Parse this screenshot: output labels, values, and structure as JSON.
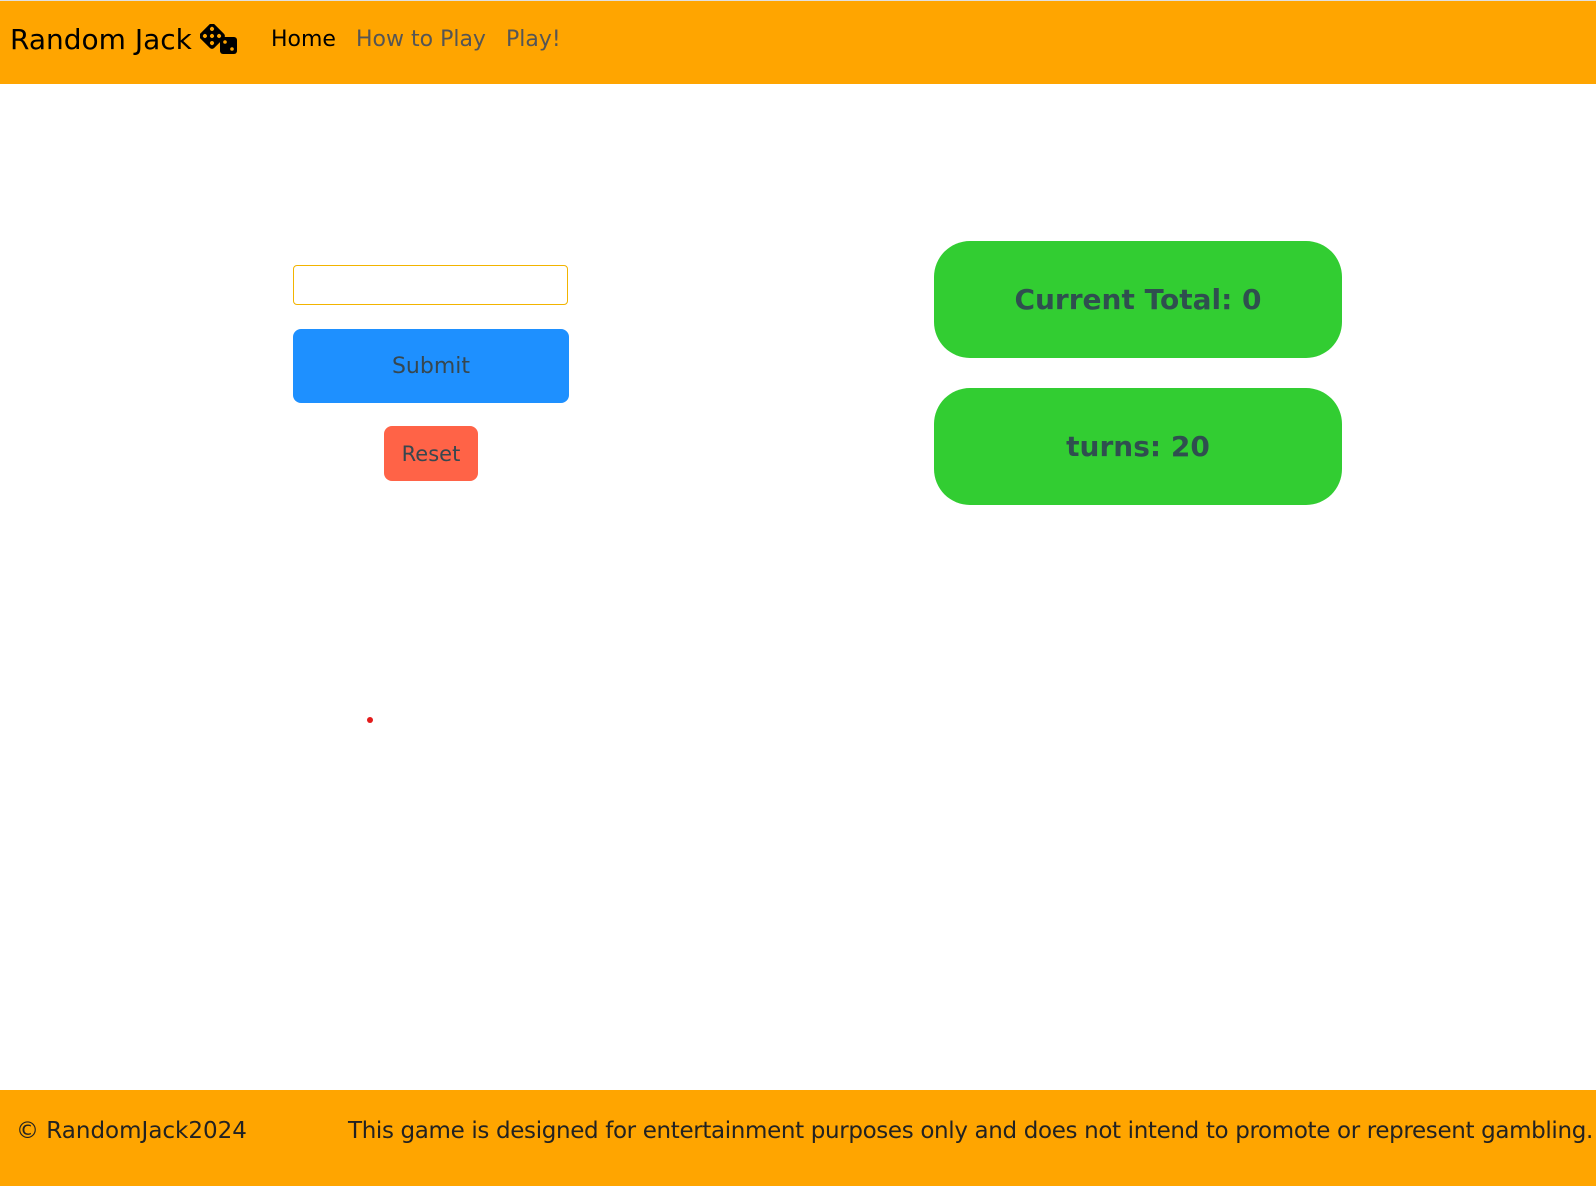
{
  "navbar": {
    "brand": "Random Jack",
    "brand_icon": "dice-icon",
    "links": [
      {
        "label": "Home",
        "active": true
      },
      {
        "label": "How to Play",
        "active": false
      },
      {
        "label": "Play!",
        "active": false
      }
    ]
  },
  "game": {
    "input_value": "",
    "submit_label": "Submit",
    "reset_label": "Reset",
    "current_total": "Current Total: 0",
    "turns": "turns: 20"
  },
  "footer": {
    "copyright": "© RandomJack2024",
    "disclaimer": "This game is designed for entertainment purposes only and does not intend to promote or represent gambling."
  },
  "colors": {
    "navbar_bg": "#FFA500",
    "submit_bg": "#1E90FF",
    "reset_bg": "#FF6347",
    "stat_bg": "#32CD32",
    "stat_text": "#2F4F4F"
  }
}
